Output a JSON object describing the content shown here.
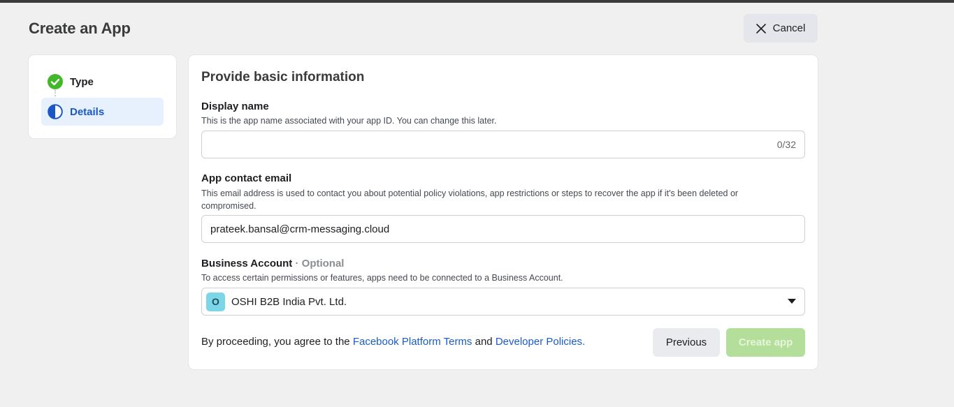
{
  "header": {
    "title": "Create an App",
    "cancel_label": "Cancel"
  },
  "steps": [
    {
      "label": "Type",
      "status": "complete",
      "icon": "check-circle-icon"
    },
    {
      "label": "Details",
      "status": "current",
      "icon": "half-circle-icon"
    }
  ],
  "form": {
    "title": "Provide basic information",
    "display_name": {
      "label": "Display name",
      "help": "This is the app name associated with your app ID. You can change this later.",
      "value": "",
      "counter": "0/32"
    },
    "contact_email": {
      "label": "App contact email",
      "help": "This email address is used to contact you about potential policy violations, app restrictions or steps to recover the app if it's been deleted or compromised.",
      "value": "prateek.bansal@crm-messaging.cloud"
    },
    "business_account": {
      "label": "Business Account",
      "optional": "· Optional",
      "help": "To access certain permissions or features, apps need to be connected to a Business Account.",
      "avatar_letter": "O",
      "selected": "OSHI B2B India Pvt. Ltd."
    },
    "terms": {
      "prefix": "By proceeding, you agree to the ",
      "link1": "Facebook Platform Terms",
      "middle": " and ",
      "link2": "Developer Policies."
    },
    "previous_label": "Previous",
    "create_label": "Create app"
  },
  "colors": {
    "accent": "#1a57c7",
    "success": "#42b72a",
    "create_disabled": "#b3df9a"
  }
}
